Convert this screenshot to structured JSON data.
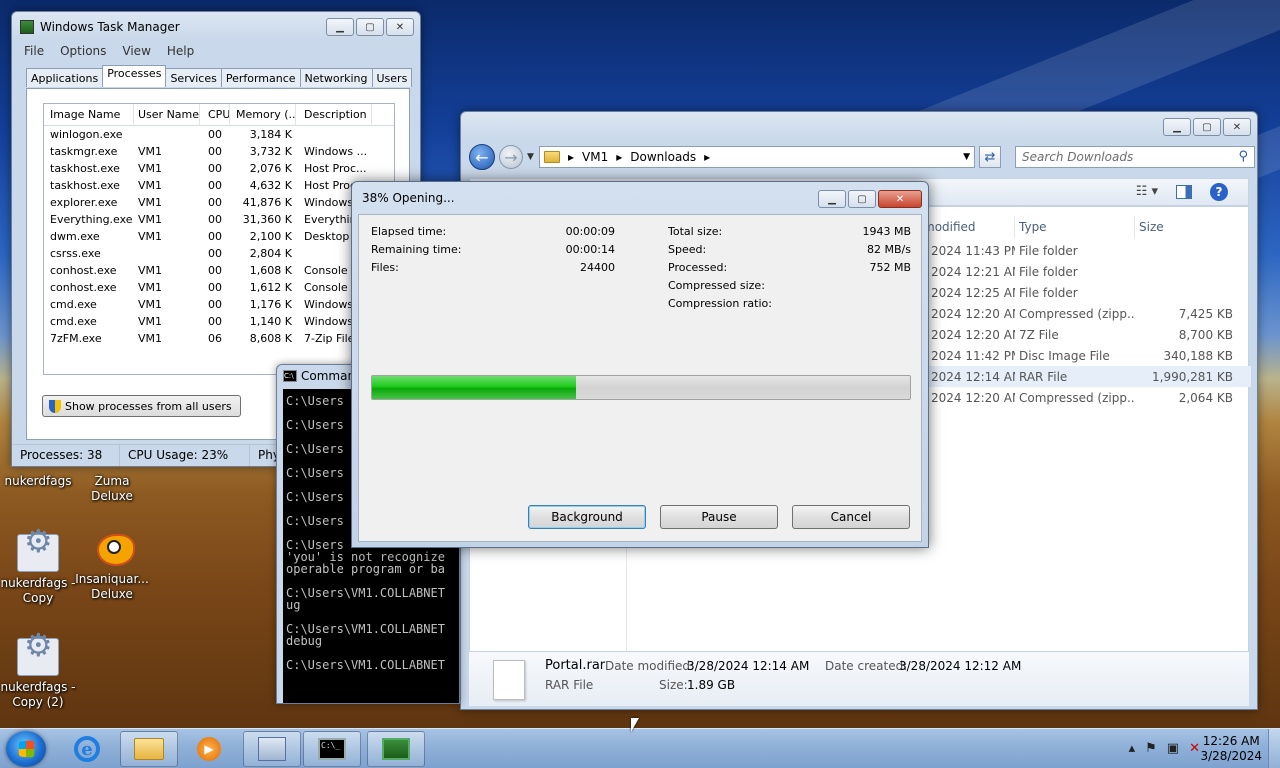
{
  "desktop": {
    "icons": [
      {
        "label": "nukerdfags",
        "kind": "none"
      },
      {
        "label": "Zuma Deluxe",
        "kind": "none"
      },
      {
        "label": "nukerdfags - Copy",
        "kind": "gear-icon"
      },
      {
        "label": "Insaniquar... Deluxe",
        "kind": "fish-icon"
      },
      {
        "label": "nukerdfags - Copy (2)",
        "kind": "gear-icon"
      }
    ]
  },
  "taskmgr": {
    "title": "Windows Task Manager",
    "menu": [
      "File",
      "Options",
      "View",
      "Help"
    ],
    "tabs": [
      "Applications",
      "Processes",
      "Services",
      "Performance",
      "Networking",
      "Users"
    ],
    "active_tab": "Processes",
    "columns": [
      "Image Name",
      "User Name",
      "CPU",
      "Memory (...",
      "Description"
    ],
    "rows": [
      [
        "winlogon.exe",
        "",
        "00",
        "3,184 K",
        ""
      ],
      [
        "taskmgr.exe",
        "VM1",
        "00",
        "3,732 K",
        "Windows ..."
      ],
      [
        "taskhost.exe",
        "VM1",
        "00",
        "2,076 K",
        "Host Proc..."
      ],
      [
        "taskhost.exe",
        "VM1",
        "00",
        "4,632 K",
        "Host Proc..."
      ],
      [
        "explorer.exe",
        "VM1",
        "00",
        "41,876 K",
        "Windows ..."
      ],
      [
        "Everything.exe",
        "VM1",
        "00",
        "31,360 K",
        "Everythin..."
      ],
      [
        "dwm.exe",
        "VM1",
        "00",
        "2,100 K",
        "Desktop ..."
      ],
      [
        "csrss.exe",
        "",
        "00",
        "2,804 K",
        ""
      ],
      [
        "conhost.exe",
        "VM1",
        "00",
        "1,608 K",
        "Console ..."
      ],
      [
        "conhost.exe",
        "VM1",
        "00",
        "1,612 K",
        "Console ..."
      ],
      [
        "cmd.exe",
        "VM1",
        "00",
        "1,176 K",
        "Windows ..."
      ],
      [
        "cmd.exe",
        "VM1",
        "00",
        "1,140 K",
        "Windows ..."
      ],
      [
        "7zFM.exe",
        "VM1",
        "06",
        "8,608 K",
        "7-Zip File..."
      ]
    ],
    "show_all_button": "Show processes from all users",
    "status": {
      "processes": "Processes: 38",
      "cpu": "CPU Usage: 23%",
      "phys": "Phy"
    }
  },
  "explorer": {
    "breadcrumb": [
      "VM1",
      "Downloads"
    ],
    "search_placeholder": "Search Downloads",
    "columns": [
      "modified",
      "Type",
      "Size"
    ],
    "rows": [
      {
        "date": "2024 11:43 PM",
        "type": "File folder",
        "size": ""
      },
      {
        "date": "2024 12:21 AM",
        "type": "File folder",
        "size": ""
      },
      {
        "date": "2024 12:25 AM",
        "type": "File folder",
        "size": ""
      },
      {
        "date": "2024 12:20 AM",
        "type": "Compressed (zipp...",
        "size": "7,425 KB"
      },
      {
        "date": "2024 12:20 AM",
        "type": "7Z File",
        "size": "8,700 KB"
      },
      {
        "date": "2024 11:42 PM",
        "type": "Disc Image File",
        "size": "340,188 KB"
      },
      {
        "date": "2024 12:14 AM",
        "type": "RAR File",
        "size": "1,990,281 KB"
      },
      {
        "date": "2024 12:20 AM",
        "type": "Compressed (zipp...",
        "size": "2,064 KB"
      }
    ],
    "selected_row": 6,
    "details": {
      "name": "Portal.rar",
      "type": "RAR File",
      "modified_label": "Date modified:",
      "modified": "3/28/2024 12:14 AM",
      "created_label": "Date created:",
      "created": "3/28/2024 12:12 AM",
      "size_label": "Size:",
      "size": "1.89 GB"
    }
  },
  "cmd": {
    "title": "Comman",
    "lines": [
      "C:\\Users",
      "",
      "C:\\Users",
      "",
      "C:\\Users",
      "",
      "C:\\Users",
      "",
      "C:\\Users",
      "",
      "C:\\Users",
      "",
      "C:\\Users",
      "'you' is not recognize",
      "operable program or ba",
      "",
      "C:\\Users\\VM1.COLLABNET",
      "ug",
      "",
      "C:\\Users\\VM1.COLLABNET",
      "debug",
      "",
      "C:\\Users\\VM1.COLLABNET"
    ]
  },
  "dialog": {
    "title": "38% Opening...",
    "progress_percent": 38,
    "left": [
      {
        "label": "Elapsed time:",
        "value": "00:00:09"
      },
      {
        "label": "Remaining time:",
        "value": "00:00:14"
      },
      {
        "label": "Files:",
        "value": "24400"
      }
    ],
    "right": [
      {
        "label": "Total size:",
        "value": "1943 MB"
      },
      {
        "label": "Speed:",
        "value": "82 MB/s"
      },
      {
        "label": "Processed:",
        "value": "752 MB"
      },
      {
        "label": "Compressed size:",
        "value": ""
      },
      {
        "label": "Compression ratio:",
        "value": ""
      }
    ],
    "buttons": {
      "background": "Background",
      "pause": "Pause",
      "cancel": "Cancel"
    }
  },
  "taskbar": {
    "time": "12:26 AM",
    "date": "3/28/2024"
  }
}
